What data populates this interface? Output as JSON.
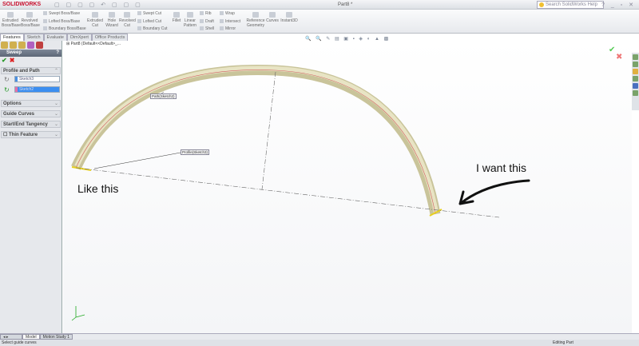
{
  "app": {
    "logo": "SOLIDWORKS",
    "title": "Part8 *",
    "search_placeholder": "Search SolidWorks Help"
  },
  "ribbon": {
    "big": [
      "Extruded Boss/Base",
      "Revolved Boss/Base",
      "Extruded Cut",
      "Hole Wizard",
      "Revolved Cut",
      "Fillet",
      "Linear Pattern",
      "Reference Geometry",
      "Curves",
      "Instant3D"
    ],
    "small": [
      "Swept Boss/Base",
      "Lofted Boss/Base",
      "Boundary Boss/Base",
      "Swept Cut",
      "Lofted Cut",
      "Boundary Cut",
      "Rib",
      "Draft",
      "Shell",
      "Wrap",
      "Intersect",
      "Mirror"
    ]
  },
  "tabs": [
    "Features",
    "Sketch",
    "Evaluate",
    "DimXpert",
    "Office Products"
  ],
  "tree": {
    "root": "Part8 (Default<<Default>_..."
  },
  "property_manager": {
    "title": "Sweep",
    "help": "?",
    "groups": {
      "profile_path": "Profile and Path",
      "options": "Options",
      "guide_curves": "Guide Curves",
      "tangency": "Start/End Tangency",
      "thin": "Thin Feature"
    },
    "profile": "Sketch3",
    "path": "Sketch2",
    "colors": {
      "profile": "#4a90e2",
      "path": "#e46fa8"
    }
  },
  "viewport": {
    "path_label": "Path(Sketch2)",
    "profile_label": "Profile(Sketch3)",
    "annotation_left": "Like this",
    "annotation_right": "I want this"
  },
  "bottom_tabs": [
    "Model",
    "Motion Study 1"
  ],
  "status": {
    "message": "Select guide curves",
    "mode": "Editing Part"
  }
}
